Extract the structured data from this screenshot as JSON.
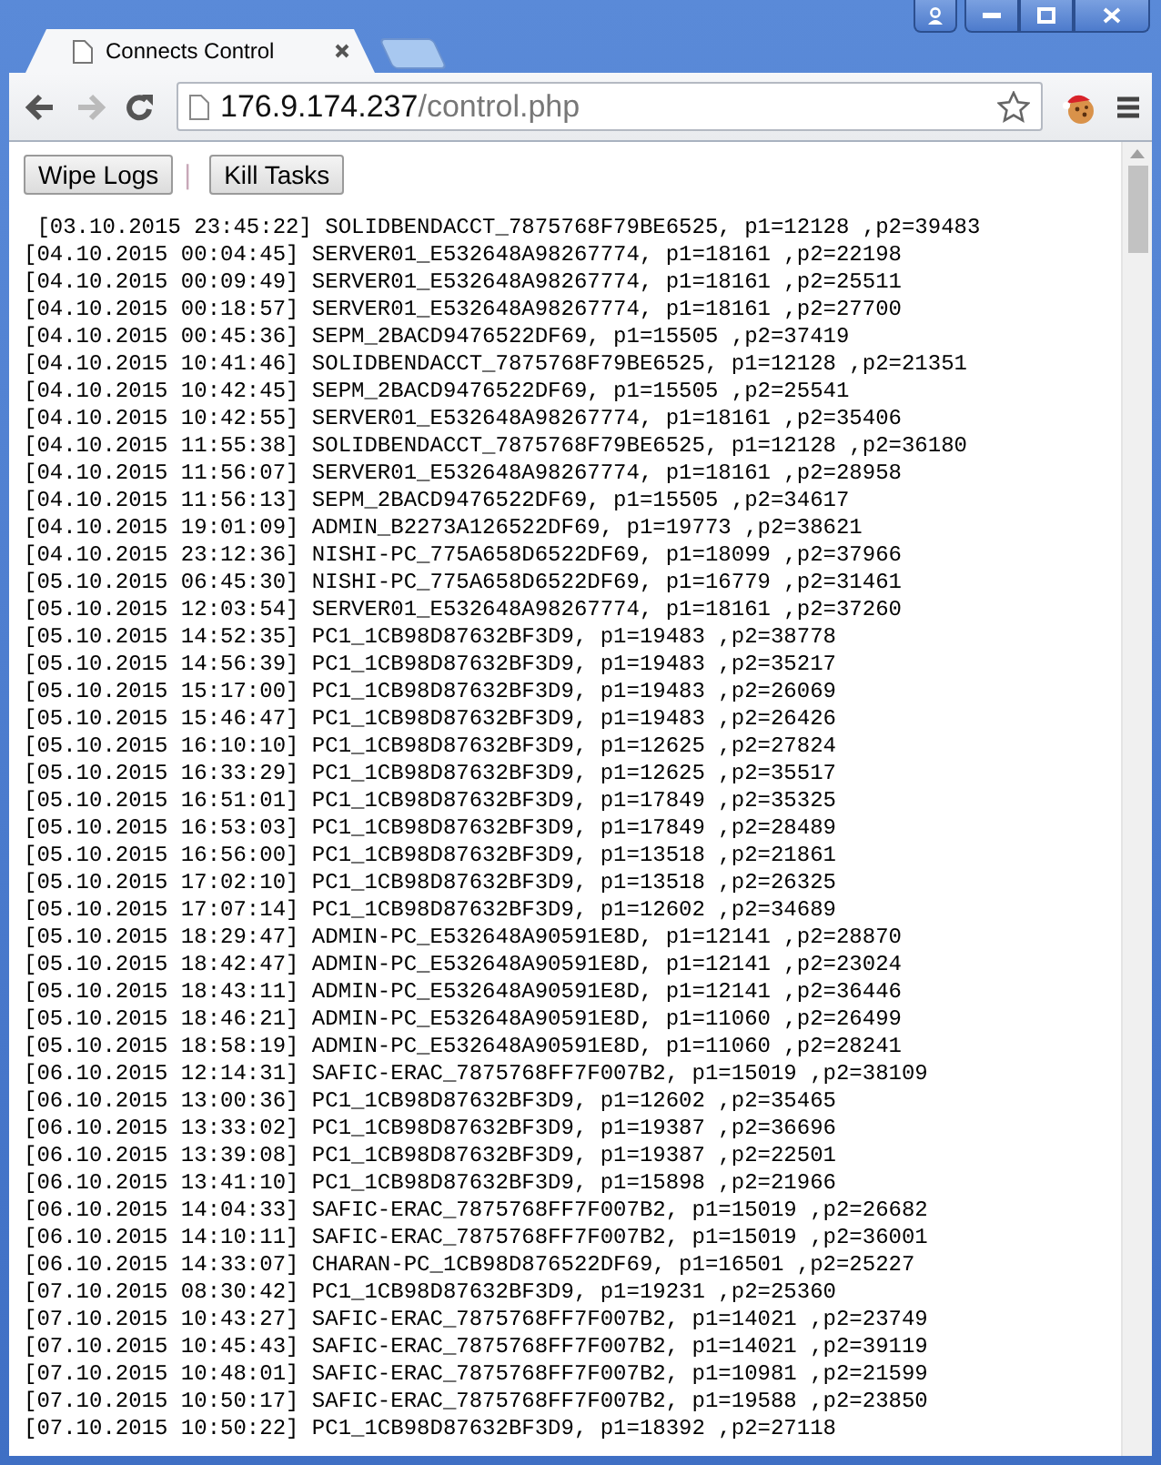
{
  "tab": {
    "title": "Connects Control"
  },
  "address": {
    "host": "176.9.174.237",
    "path": "/control.php"
  },
  "toolbar": {
    "forward_disabled": true
  },
  "buttons": [
    "Wipe Logs",
    "Kill Tasks"
  ],
  "separator": "|",
  "log_lines": [
    " [03.10.2015 23:45:22] SOLIDBENDACCT_7875768F79BE6525, p1=12128 ,p2=39483",
    "[04.10.2015 00:04:45] SERVER01_E532648A98267774, p1=18161 ,p2=22198",
    "[04.10.2015 00:09:49] SERVER01_E532648A98267774, p1=18161 ,p2=25511",
    "[04.10.2015 00:18:57] SERVER01_E532648A98267774, p1=18161 ,p2=27700",
    "[04.10.2015 00:45:36] SEPM_2BACD9476522DF69, p1=15505 ,p2=37419",
    "[04.10.2015 10:41:46] SOLIDBENDACCT_7875768F79BE6525, p1=12128 ,p2=21351",
    "[04.10.2015 10:42:45] SEPM_2BACD9476522DF69, p1=15505 ,p2=25541",
    "[04.10.2015 10:42:55] SERVER01_E532648A98267774, p1=18161 ,p2=35406",
    "[04.10.2015 11:55:38] SOLIDBENDACCT_7875768F79BE6525, p1=12128 ,p2=36180",
    "[04.10.2015 11:56:07] SERVER01_E532648A98267774, p1=18161 ,p2=28958",
    "[04.10.2015 11:56:13] SEPM_2BACD9476522DF69, p1=15505 ,p2=34617",
    "[04.10.2015 19:01:09] ADMIN_B2273A126522DF69, p1=19773 ,p2=38621",
    "[04.10.2015 23:12:36] NISHI-PC_775A658D6522DF69, p1=18099 ,p2=37966",
    "[05.10.2015 06:45:30] NISHI-PC_775A658D6522DF69, p1=16779 ,p2=31461",
    "[05.10.2015 12:03:54] SERVER01_E532648A98267774, p1=18161 ,p2=37260",
    "[05.10.2015 14:52:35] PC1_1CB98D87632BF3D9, p1=19483 ,p2=38778",
    "[05.10.2015 14:56:39] PC1_1CB98D87632BF3D9, p1=19483 ,p2=35217",
    "[05.10.2015 15:17:00] PC1_1CB98D87632BF3D9, p1=19483 ,p2=26069",
    "[05.10.2015 15:46:47] PC1_1CB98D87632BF3D9, p1=19483 ,p2=26426",
    "[05.10.2015 16:10:10] PC1_1CB98D87632BF3D9, p1=12625 ,p2=27824",
    "[05.10.2015 16:33:29] PC1_1CB98D87632BF3D9, p1=12625 ,p2=35517",
    "[05.10.2015 16:51:01] PC1_1CB98D87632BF3D9, p1=17849 ,p2=35325",
    "[05.10.2015 16:53:03] PC1_1CB98D87632BF3D9, p1=17849 ,p2=28489",
    "[05.10.2015 16:56:00] PC1_1CB98D87632BF3D9, p1=13518 ,p2=21861",
    "[05.10.2015 17:02:10] PC1_1CB98D87632BF3D9, p1=13518 ,p2=26325",
    "[05.10.2015 17:07:14] PC1_1CB98D87632BF3D9, p1=12602 ,p2=34689",
    "[05.10.2015 18:29:47] ADMIN-PC_E532648A90591E8D, p1=12141 ,p2=28870",
    "[05.10.2015 18:42:47] ADMIN-PC_E532648A90591E8D, p1=12141 ,p2=23024",
    "[05.10.2015 18:43:11] ADMIN-PC_E532648A90591E8D, p1=12141 ,p2=36446",
    "[05.10.2015 18:46:21] ADMIN-PC_E532648A90591E8D, p1=11060 ,p2=26499",
    "[05.10.2015 18:58:19] ADMIN-PC_E532648A90591E8D, p1=11060 ,p2=28241",
    "[06.10.2015 12:14:31] SAFIC-ERAC_7875768FF7F007B2, p1=15019 ,p2=38109",
    "[06.10.2015 13:00:36] PC1_1CB98D87632BF3D9, p1=12602 ,p2=35465",
    "[06.10.2015 13:33:02] PC1_1CB98D87632BF3D9, p1=19387 ,p2=36696",
    "[06.10.2015 13:39:08] PC1_1CB98D87632BF3D9, p1=19387 ,p2=22501",
    "[06.10.2015 13:41:10] PC1_1CB98D87632BF3D9, p1=15898 ,p2=21966",
    "[06.10.2015 14:04:33] SAFIC-ERAC_7875768FF7F007B2, p1=15019 ,p2=26682",
    "[06.10.2015 14:10:11] SAFIC-ERAC_7875768FF7F007B2, p1=15019 ,p2=36001",
    "[06.10.2015 14:33:07] CHARAN-PC_1CB98D876522DF69, p1=16501 ,p2=25227",
    "[07.10.2015 08:30:42] PC1_1CB98D87632BF3D9, p1=19231 ,p2=25360",
    "[07.10.2015 10:43:27] SAFIC-ERAC_7875768FF7F007B2, p1=14021 ,p2=23749",
    "[07.10.2015 10:45:43] SAFIC-ERAC_7875768FF7F007B2, p1=14021 ,p2=39119",
    "[07.10.2015 10:48:01] SAFIC-ERAC_7875768FF7F007B2, p1=10981 ,p2=21599",
    "[07.10.2015 10:50:17] SAFIC-ERAC_7875768FF7F007B2, p1=19588 ,p2=23850",
    "[07.10.2015 10:50:22] PC1_1CB98D87632BF3D9, p1=18392 ,p2=27118"
  ]
}
